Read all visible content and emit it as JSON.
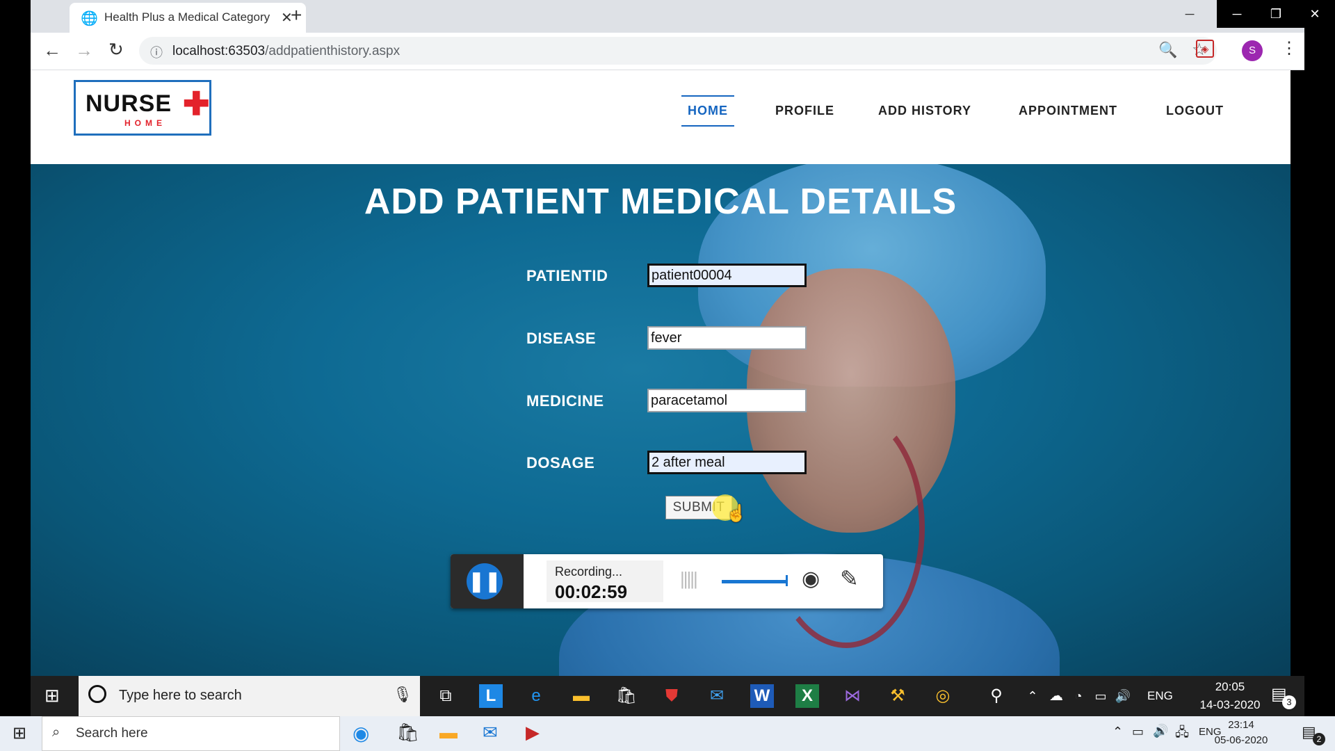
{
  "browser": {
    "tab_title": "Health Plus a Medical Category E",
    "url_host": "localhost:63503",
    "url_path": "/addpatienthistory.aspx",
    "profile_initial": "S"
  },
  "site": {
    "logo_text": "NURSE",
    "logo_plus": "✚",
    "logo_sub": "HOME",
    "nav": [
      "HOME",
      "PROFILE",
      "ADD HISTORY",
      "APPOINTMENT",
      "LOGOUT"
    ]
  },
  "form": {
    "heading": "ADD PATIENT MEDICAL DETAILS",
    "fields": [
      {
        "label": "PATIENTID",
        "value": "patient00004"
      },
      {
        "label": "DISEASE",
        "value": "fever"
      },
      {
        "label": "MEDICINE",
        "value": "paracetamol"
      },
      {
        "label": "DOSAGE",
        "value": "2 after meal"
      }
    ],
    "submit_label": "SUBMIT"
  },
  "recorder": {
    "status": "Recording...",
    "timer": "00:02:59"
  },
  "taskbar_inner": {
    "search_placeholder": "Type here to search",
    "language": "ENG",
    "time": "20:05",
    "date": "14-03-2020",
    "notifications": "3"
  },
  "taskbar_outer": {
    "search_placeholder": "Search here",
    "language": "ENG",
    "time": "23:14",
    "date": "05-06-2020",
    "notifications": "2"
  },
  "colors": {
    "accent": "#1565c0",
    "hero": "#0e6a93",
    "logo_red": "#e3222b"
  }
}
